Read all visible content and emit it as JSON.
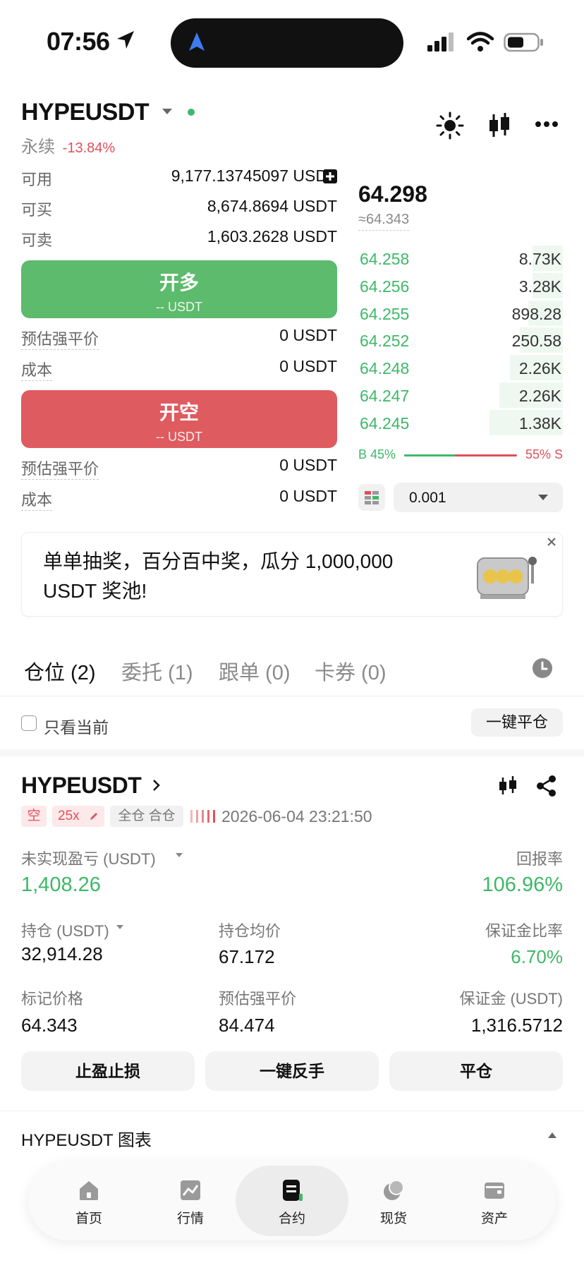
{
  "status": {
    "time": "07:56"
  },
  "header": {
    "symbol": "HYPEUSDT",
    "perpetual_label": "永续",
    "change_pct": "-13.84%"
  },
  "account": {
    "available_label": "可用",
    "available_value": "9,177.13745097 USDT",
    "buyable_label": "可买",
    "buyable_value": "8,674.8694 USDT",
    "sellable_label": "可卖",
    "sellable_value": "1,603.2628 USDT"
  },
  "long": {
    "button_label": "开多",
    "button_sub": "-- USDT",
    "liq_label": "预估强平价",
    "liq_value": "0 USDT",
    "cost_label": "成本",
    "cost_value": "0 USDT"
  },
  "short": {
    "button_label": "开空",
    "button_sub": "-- USDT",
    "liq_label": "预估强平价",
    "liq_value": "0 USDT",
    "cost_label": "成本",
    "cost_value": "0 USDT"
  },
  "orderbook": {
    "last_price": "64.298",
    "mark_price": "≈64.343",
    "bids": [
      {
        "price": "64.258",
        "qty": "8.73K",
        "depth": 0.15
      },
      {
        "price": "64.256",
        "qty": "3.28K",
        "depth": 0.15
      },
      {
        "price": "64.255",
        "qty": "898.28",
        "depth": 0.17
      },
      {
        "price": "64.252",
        "qty": "250.58",
        "depth": 0.21
      },
      {
        "price": "64.248",
        "qty": "2.26K",
        "depth": 0.26
      },
      {
        "price": "64.247",
        "qty": "2.26K",
        "depth": 0.31
      },
      {
        "price": "64.245",
        "qty": "1.38K",
        "depth": 0.36
      }
    ],
    "buy_ratio_label": "B 45%",
    "sell_ratio_label": "55% S",
    "buy_ratio": 0.45,
    "precision": "0.001"
  },
  "banner": {
    "text_line1": "单单抽奖，百分百中奖，瓜分 1,000,000",
    "text_line2": "USDT 奖池!"
  },
  "tabs": [
    {
      "label": "仓位 (2)"
    },
    {
      "label": "委托 (1)"
    },
    {
      "label": "跟单 (0)"
    },
    {
      "label": "卡券 (0)"
    }
  ],
  "filter": {
    "only_current_label": "只看当前",
    "close_all_label": "一键平仓"
  },
  "position": {
    "symbol": "HYPEUSDT",
    "side_tag": "空",
    "leverage_tag": "25x",
    "margin_mode_tag": "全仓 合仓",
    "opened_at": "2026-06-04 23:21:50",
    "unrealized_label": "未实现盈亏 (USDT)",
    "unrealized_value": "1,408.26",
    "roe_label": "回报率",
    "roe_value": "106.96%",
    "size_label": "持仓 (USDT)",
    "size_value": "32,914.28",
    "entry_label": "持仓均价",
    "entry_value": "67.172",
    "margin_ratio_label": "保证金比率",
    "margin_ratio_value": "6.70%",
    "mark_label": "标记价格",
    "mark_value": "64.343",
    "liq_label": "预估强平价",
    "liq_value": "84.474",
    "margin_label": "保证金 (USDT)",
    "margin_value": "1,316.5712",
    "tp_sl_label": "止盈止损",
    "reverse_label": "一键反手",
    "close_label": "平仓"
  },
  "chart_section": {
    "title": "HYPEUSDT 图表"
  },
  "nav": [
    {
      "label": "首页",
      "icon": "home-icon"
    },
    {
      "label": "行情",
      "icon": "market-icon"
    },
    {
      "label": "合约",
      "icon": "futures-icon"
    },
    {
      "label": "现货",
      "icon": "spot-icon"
    },
    {
      "label": "资产",
      "icon": "wallet-icon"
    }
  ],
  "colors": {
    "green": "#3fb868",
    "red": "#e0505a",
    "long_button": "#5cbb6c",
    "short_button": "#de5b60"
  }
}
